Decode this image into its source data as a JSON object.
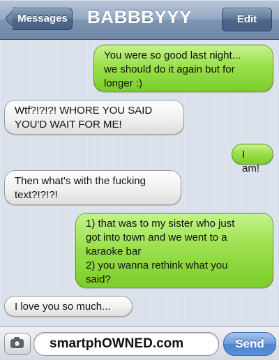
{
  "header": {
    "back_label": "Messages",
    "title": "BABBBYYY",
    "edit_label": "Edit"
  },
  "messages": [
    {
      "from": "me",
      "text": "You were so good last night...\nwe should do it again but for\nlonger :)"
    },
    {
      "from": "them",
      "text": "Wtf?!?!?! WHORE YOU SAID\nYOU'D WAIT FOR ME!"
    },
    {
      "from": "me",
      "text": "I am!"
    },
    {
      "from": "them",
      "text": "Then what's with the fucking\ntext?!?!?!"
    },
    {
      "from": "me",
      "text": "1) that was to my sister who just\ngot into town and we went to a\nkaraoke bar\n2) you wanna rethink what you\nsaid?"
    },
    {
      "from": "them",
      "text": "I love you so much..."
    }
  ],
  "composer": {
    "input_value": "smartphOWNED.com",
    "send_label": "Send",
    "camera_icon": "camera-icon"
  },
  "colors": {
    "sent_bubble": "#8ad63c",
    "received_bubble": "#ececec",
    "navbar": "#8ea2bd",
    "send_button": "#5a8fd8"
  }
}
